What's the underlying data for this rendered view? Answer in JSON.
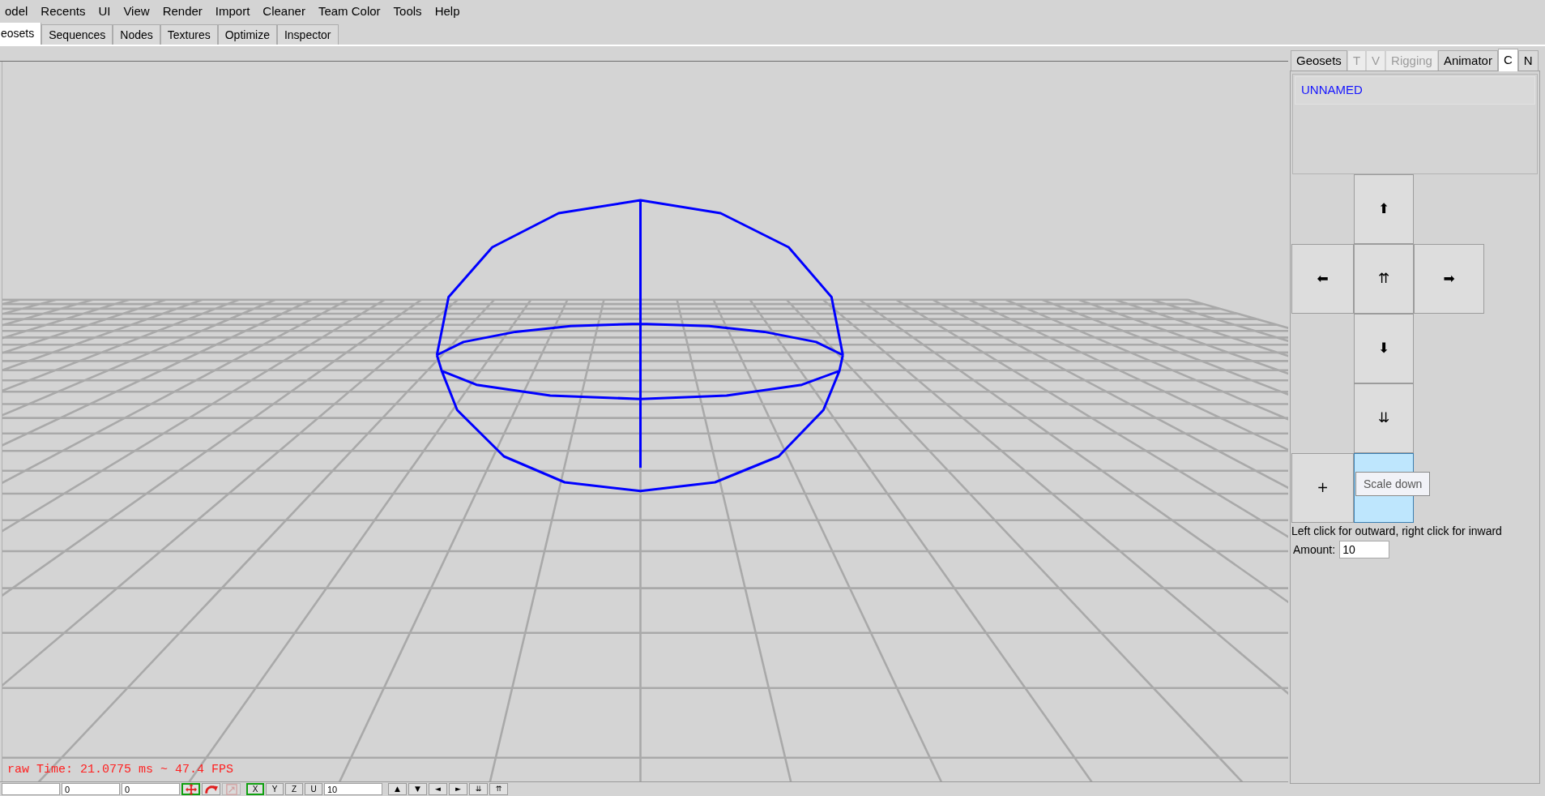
{
  "menu_bar": {
    "items": [
      "odel",
      "Recents",
      "UI",
      "View",
      "Render",
      "Import",
      "Cleaner",
      "Team Color",
      "Tools",
      "Help"
    ]
  },
  "tabs": [
    {
      "label": "eosets",
      "selected": true
    },
    {
      "label": "Sequences",
      "selected": false
    },
    {
      "label": "Nodes",
      "selected": false
    },
    {
      "label": "Textures",
      "selected": false
    },
    {
      "label": "Optimize",
      "selected": false
    },
    {
      "label": "Inspector",
      "selected": false
    }
  ],
  "viewport": {
    "stats_text": "raw Time: 21.0775 ms ~ 47.4 FPS"
  },
  "toolbar": {
    "items": [
      {
        "kind": "field"
      },
      {
        "kind": "field",
        "value": "0"
      },
      {
        "kind": "field",
        "value": "0"
      },
      {
        "kind": "tool",
        "selected": true,
        "disabled": false
      },
      {
        "kind": "tool",
        "selected": false,
        "disabled": false
      },
      {
        "kind": "tool",
        "selected": false,
        "disabled": true
      },
      {
        "kind": "toggle",
        "label": "X",
        "selected": true
      },
      {
        "kind": "toggle",
        "label": "Y",
        "selected": false
      },
      {
        "kind": "toggle",
        "label": "Z",
        "selected": false
      },
      {
        "kind": "toggle",
        "label": "U",
        "selected": false
      },
      {
        "kind": "field",
        "value": "10"
      },
      {
        "kind": "button",
        "label": "▲"
      },
      {
        "kind": "button",
        "label": "▼"
      },
      {
        "kind": "button",
        "label": "◄"
      },
      {
        "kind": "button",
        "label": "►"
      },
      {
        "kind": "button",
        "label": "⇊"
      },
      {
        "kind": "button",
        "label": "⇈"
      }
    ]
  },
  "side_panel": {
    "tabs": [
      {
        "label": "Geosets",
        "selected": false,
        "disabled": false
      },
      {
        "label": "T",
        "selected": false,
        "disabled": true
      },
      {
        "label": "V",
        "selected": false,
        "disabled": true
      },
      {
        "label": "Rigging",
        "selected": false,
        "disabled": true
      },
      {
        "label": "Animator",
        "selected": false,
        "disabled": false
      },
      {
        "label": "C",
        "selected": true,
        "disabled": false
      },
      {
        "label": "N",
        "selected": false,
        "disabled": false
      }
    ],
    "list": {
      "items": [
        {
          "label": "UNNAMED",
          "selected": true
        }
      ]
    },
    "pad": {
      "buttons": [
        {
          "label": "⬆",
          "hovered": false
        },
        {
          "label": "⬅",
          "hovered": false
        },
        {
          "label": "⇈",
          "hovered": false
        },
        {
          "label": "➡",
          "hovered": false
        },
        {
          "label": "⬇",
          "hovered": false
        },
        {
          "label": "⇊",
          "hovered": false
        },
        {
          "label": "+",
          "hovered": false
        },
        {
          "hovered": true,
          "tooltip": "Scale down"
        }
      ]
    },
    "hint": "Left click for outward, right click for inward",
    "amount": {
      "label": "Amount:",
      "value": "10"
    }
  }
}
